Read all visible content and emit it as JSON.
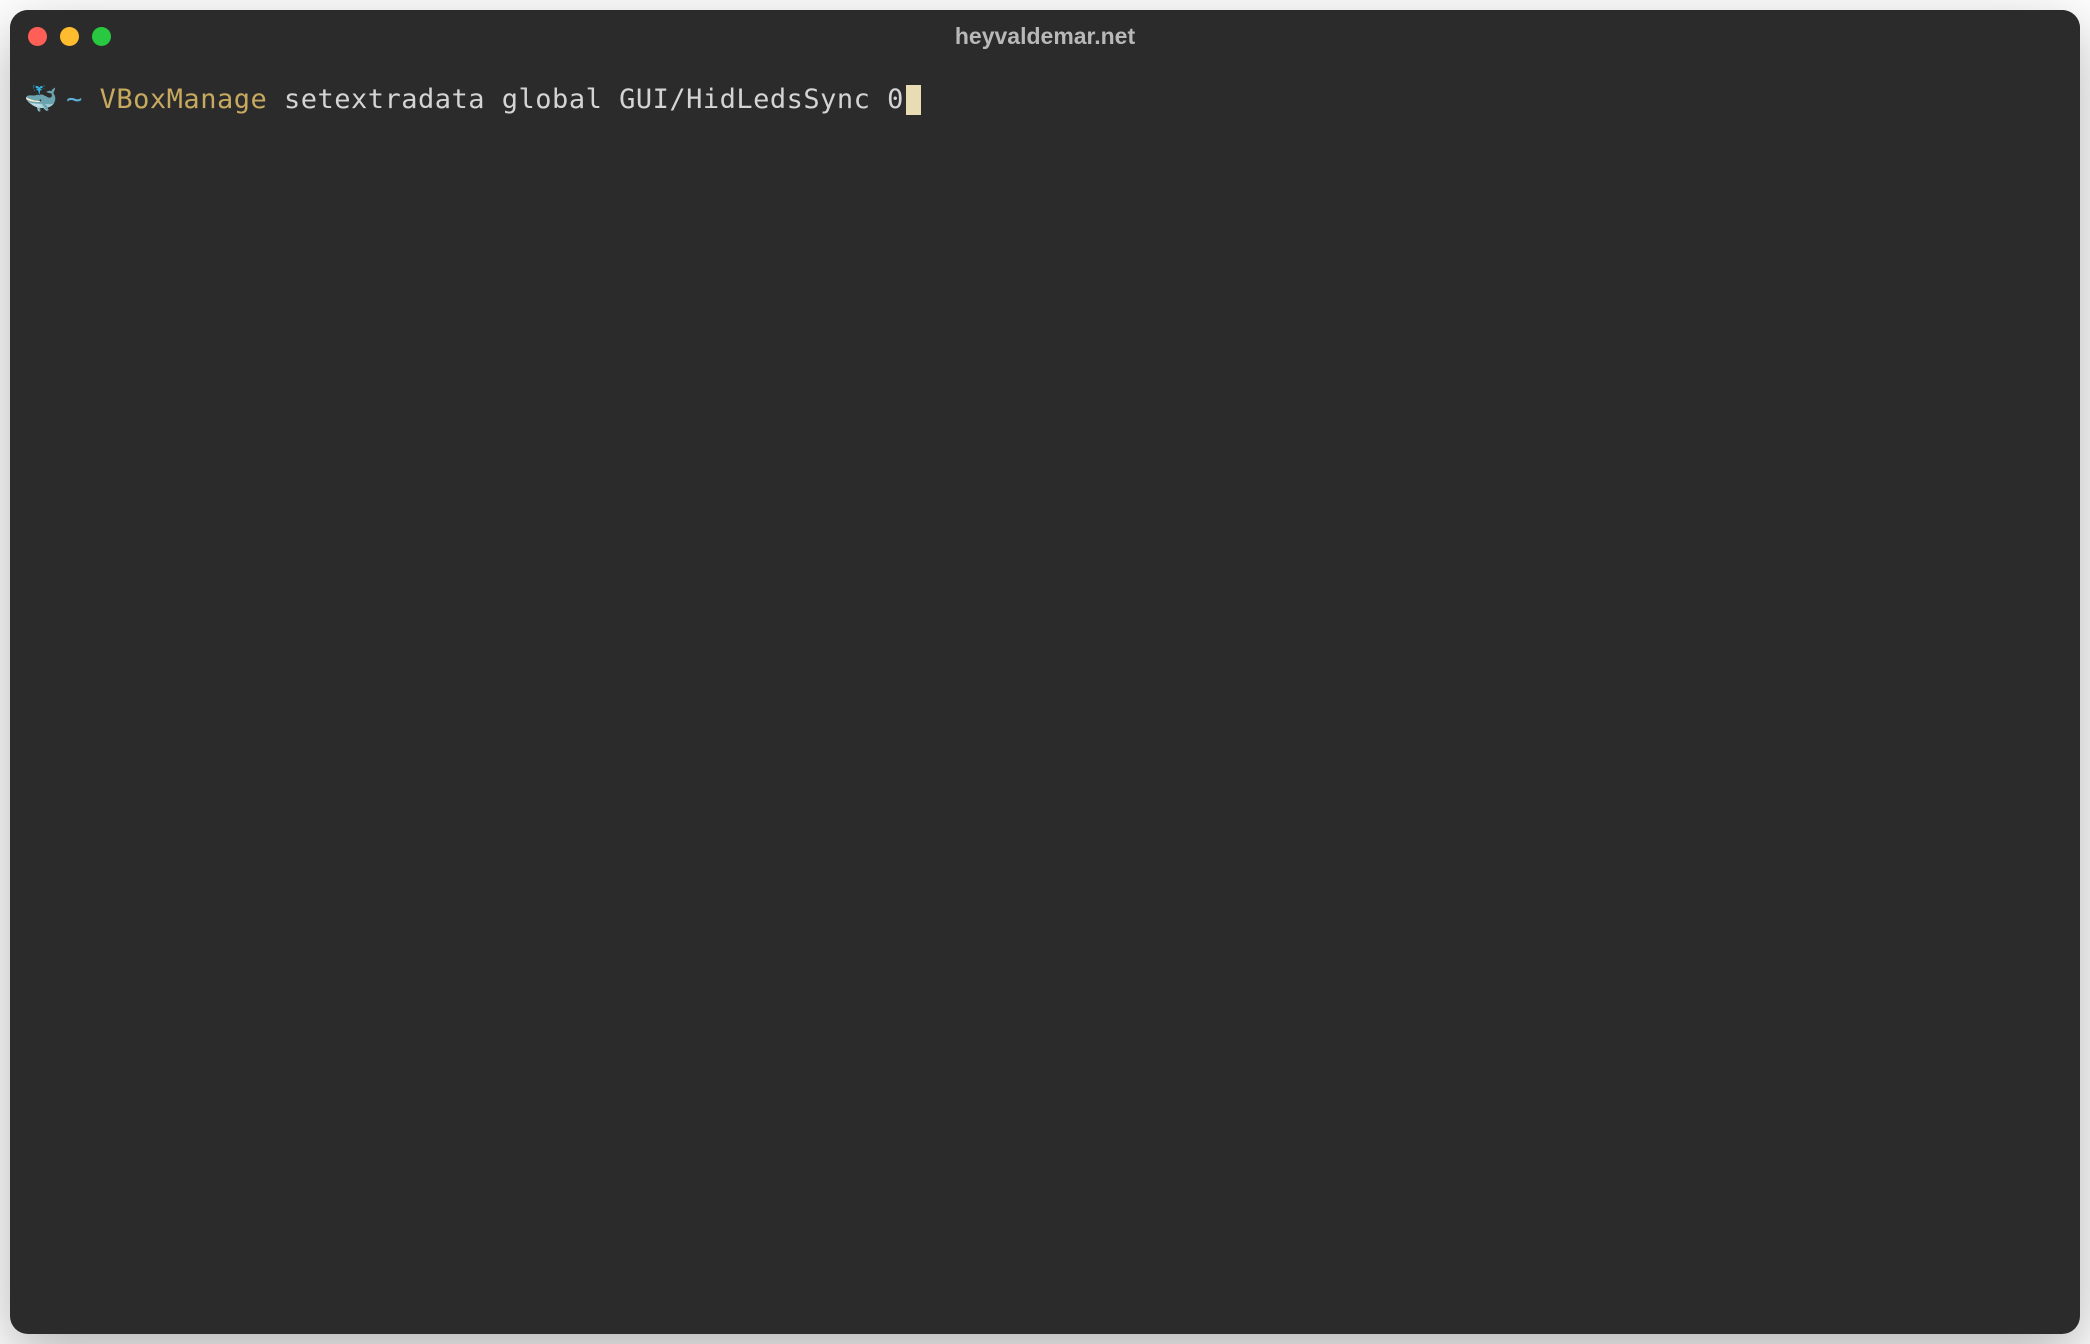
{
  "window": {
    "title": "heyvaldemar.net"
  },
  "prompt": {
    "icon": "🐳",
    "tilde": "~",
    "command": "VBoxManage",
    "args": " setextradata global GUI/HidLedsSync 0"
  },
  "colors": {
    "window_bg": "#2b2b2b",
    "title_text": "#b8b8b8",
    "tilde": "#5fb0d8",
    "command": "#c7a95f",
    "args": "#d4d4d4",
    "cursor": "#e8dcb5",
    "traffic_red": "#ff5f57",
    "traffic_yellow": "#febc2e",
    "traffic_green": "#28c840"
  }
}
